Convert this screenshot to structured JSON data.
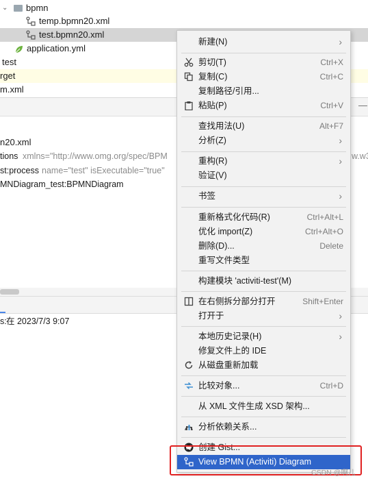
{
  "tree": {
    "folder": "bpmn",
    "file1": "temp.bpmn20.xml",
    "file2": "test.bpmn20.xml",
    "file3": "application.yml",
    "item_test": "test",
    "item_target": "rget",
    "item_pom": "m.xml"
  },
  "editor": {
    "filename": "n20.xml",
    "line1_a": "tions",
    "line1_b": "xmlns=\"http://www.omg.org/spec/BPM",
    "line1_c": "w.w3",
    "line2_a": "st:process",
    "line2_b": "name=\"test\" isExecutable=\"true\"",
    "line3": "MNDiagram_test:BPMNDiagram",
    "minimize": "—"
  },
  "bottom": {
    "commit_prefix": "s:",
    "commit_date": "在 2023/7/3 9:07"
  },
  "menu": {
    "new": "新建(N)",
    "cut": "剪切(T)",
    "cut_sc": "Ctrl+X",
    "copy": "复制(C)",
    "copy_sc": "Ctrl+C",
    "copy_path": "复制路径/引用...",
    "paste": "粘贴(P)",
    "paste_sc": "Ctrl+V",
    "find_usages": "查找用法(U)",
    "find_usages_sc": "Alt+F7",
    "analyze": "分析(Z)",
    "refactor": "重构(R)",
    "validate": "验证(V)",
    "bookmarks": "书签",
    "reformat": "重新格式化代码(R)",
    "reformat_sc": "Ctrl+Alt+L",
    "optimize": "优化 import(Z)",
    "optimize_sc": "Ctrl+Alt+O",
    "delete": "删除(D)...",
    "delete_sc": "Delete",
    "override_type": "重写文件类型",
    "build_module": "构建模块 'activiti-test'(M)",
    "split_right": "在右侧拆分部分打开",
    "split_right_sc": "Shift+Enter",
    "open_in": "打开于",
    "local_history": "本地历史记录(H)",
    "repair_ide": "修复文件上的 IDE",
    "reload": "从磁盘重新加载",
    "compare": "比较对象...",
    "compare_sc": "Ctrl+D",
    "gen_xsd": "从 XML 文件生成 XSD 架构...",
    "analyze_deps": "分析依赖关系...",
    "create_gist": "创建 Gist...",
    "view_bpmn": "View BPMN (Activiti) Diagram"
  },
  "watermark": "CSDN @啊儿"
}
